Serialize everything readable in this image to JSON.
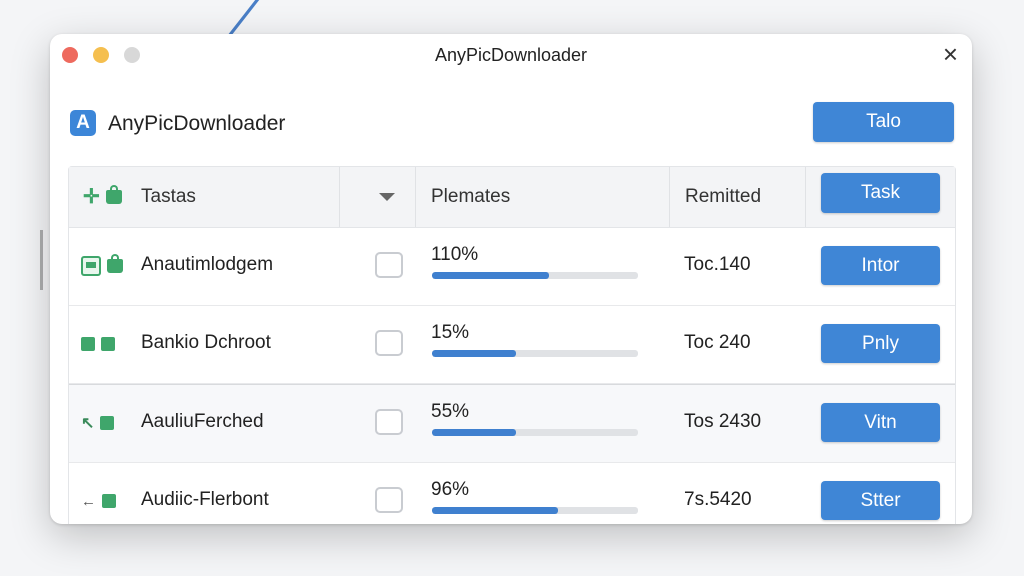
{
  "window": {
    "title": "AnyPicDownloader",
    "close_glyph": "×"
  },
  "app": {
    "logo_letter": "A",
    "name": "AnyPicDownloader",
    "header_button": "Talo"
  },
  "table": {
    "headers": {
      "name": "Tastas",
      "progress": "Plemates",
      "remitted": "Remitted",
      "action": "Task"
    },
    "rows": [
      {
        "name": "Anautimlodgem",
        "progress_text": "110%",
        "progress": 0.57,
        "remitted": "Toc.140",
        "button": "Intor",
        "icon": "image-icon"
      },
      {
        "name": "Bankio Dchroot",
        "progress_text": "15%",
        "progress": 0.41,
        "remitted": "Toc 240",
        "button": "Pnly",
        "icon": "image-icon"
      },
      {
        "name": "AauliuFerched",
        "progress_text": "55%",
        "progress": 0.41,
        "remitted": "Tos 2430",
        "button": "Vitn",
        "icon": "image-icon"
      },
      {
        "name": "Audiic-Flerbont",
        "progress_text": "96%",
        "progress": 0.61,
        "remitted": "7s.5420",
        "button": "Stter",
        "icon": "image-icon"
      }
    ]
  },
  "colors": {
    "accent": "#3f86d6",
    "green_icon": "#3fa66b",
    "progress": "#3f80cf"
  }
}
